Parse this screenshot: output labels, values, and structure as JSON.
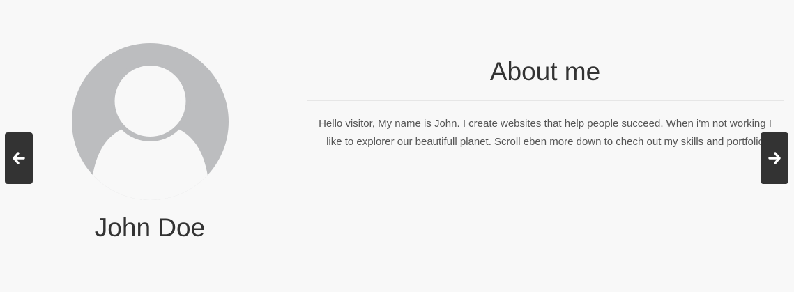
{
  "profile": {
    "name": "John Doe",
    "avatar_icon": "user-placeholder-icon"
  },
  "about": {
    "title": "About me",
    "text": "Hello visitor, My name is John. I create websites that help people succeed. When i'm not working I like to explorer our beautifull planet. Scroll eben more down to chech out my skills and portfolio"
  },
  "navigation": {
    "prev_icon": "arrow-left-icon",
    "next_icon": "arrow-right-icon"
  },
  "colors": {
    "background": "#f8f8f8",
    "avatar_circle": "#bcbdbf",
    "avatar_figure": "#f8f8f8",
    "nav_button": "#333333",
    "heading_text": "#333333",
    "body_text": "#555555"
  }
}
